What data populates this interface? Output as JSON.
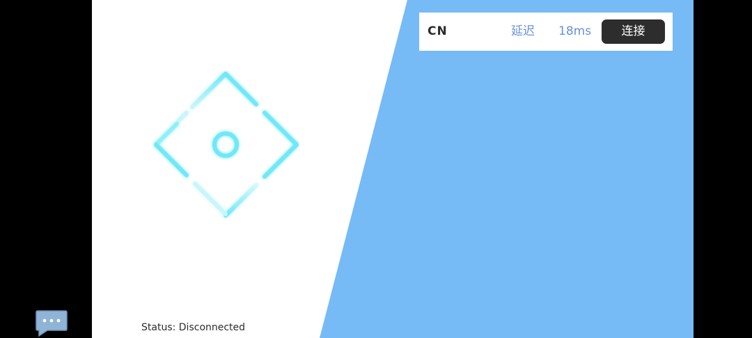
{
  "server": {
    "region": "CN",
    "latency_label": "延迟",
    "latency_value": "18ms",
    "connect_label": "连接"
  },
  "status": {
    "text": "Status: Disconnected"
  },
  "icons": {
    "logo": "diamond-ring-logo",
    "chat": "chat-bubble-icon"
  },
  "colors": {
    "accent_blue": "#76baf6",
    "logo_cyan": "#6fe8f7",
    "button_dark": "#2d2d2d",
    "latency_text": "#6a8fd8"
  }
}
